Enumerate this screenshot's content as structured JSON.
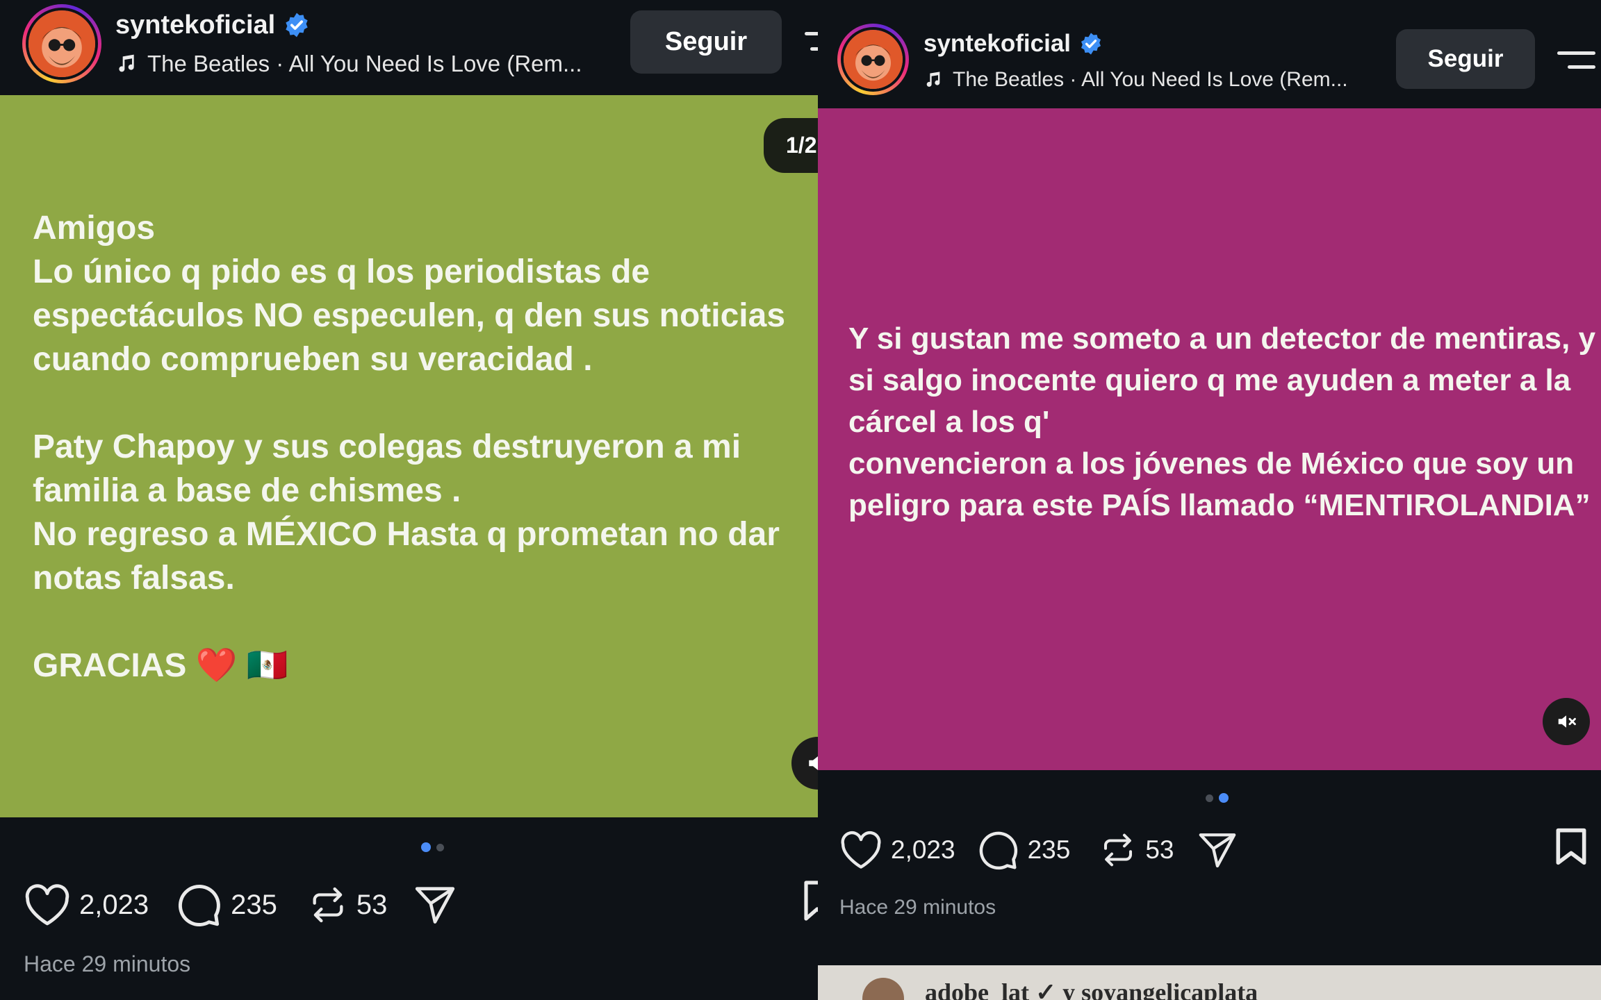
{
  "colors": {
    "slide1_bg": "#8fa845",
    "slide2_bg": "#a22b73",
    "verified": "#3d8ff5",
    "dot_active": "#4b8cf7",
    "follow_bg": "#2b2f35"
  },
  "left_post": {
    "username": "syntekoficial",
    "music": "The Beatles · All You Need Is Love (Rem...",
    "follow_label": "Seguir",
    "slide_counter": "1/2",
    "slide_text": "Amigos\nLo único q pido es q los periodistas de espectáculos NO especulen, q den sus noticias cuando comprueben su veracidad .\n\nPaty Chapoy y sus colegas destruyeron a mi familia a base de chismes .\nNo regreso a MÉXICO Hasta q prometan no dar notas falsas.\n\nGRACIAS ❤️ 🇲🇽",
    "likes": "2,023",
    "comments": "235",
    "reposts": "53",
    "timestamp": "Hace 29 minutos"
  },
  "right_post": {
    "username": "syntekoficial",
    "music": "The Beatles · All You Need Is Love (Rem...",
    "follow_label": "Seguir",
    "slide_text": "Y si gustan me someto a un detector de mentiras, y si salgo inocente quiero q me ayuden a meter a la cárcel a los q'\nconvencieron a los jóvenes de México que soy un peligro para este PAÍS llamado “MENTIROLANDIA”",
    "likes": "2,023",
    "comments": "235",
    "reposts": "53",
    "timestamp": "Hace 29 minutos",
    "next_post_text": "adobe_lat ✓ y soyangelicaplata"
  },
  "icons": {
    "verified": "verified-badge-icon",
    "music": "music-note-icon",
    "menu": "menu-icon",
    "like": "heart-icon",
    "comment": "comment-icon",
    "repost": "repost-icon",
    "share": "send-icon",
    "save": "bookmark-icon",
    "mute": "speaker-muted-icon"
  }
}
